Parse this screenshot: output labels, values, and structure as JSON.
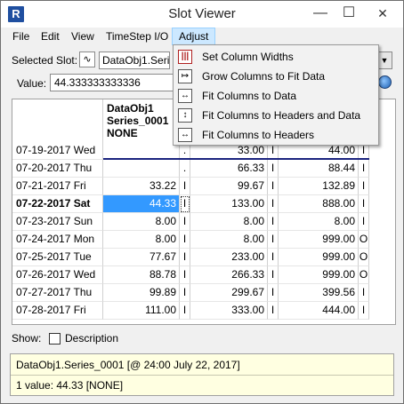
{
  "window": {
    "title": "Slot Viewer",
    "app_icon_letter": "R"
  },
  "menubar": [
    "File",
    "Edit",
    "View",
    "TimeStep I/O",
    "Adjust"
  ],
  "selected_slot": {
    "label": "Selected Slot:",
    "value": "DataObj1.Series_0001"
  },
  "value_field": {
    "label": "Value:",
    "value": "44.333333333336"
  },
  "columns": [
    {
      "header": [
        "DataObj1",
        "Series_0001",
        "NONE"
      ]
    },
    {
      "header": [
        "",
        "",
        ""
      ]
    },
    {
      "header": [
        "",
        "",
        ""
      ]
    }
  ],
  "rows": [
    {
      "date": "07-19-2017 Wed",
      "bold": false,
      "c1": "",
      "f1": ".",
      "c2": "33.00",
      "f2": "I",
      "c3": "44.00",
      "f3": "I"
    },
    {
      "date": "07-20-2017 Thu",
      "bold": false,
      "c1": "",
      "f1": ".",
      "c2": "66.33",
      "f2": "I",
      "c3": "88.44",
      "f3": "I"
    },
    {
      "date": "07-21-2017 Fri",
      "bold": false,
      "c1": "33.22",
      "f1": "I",
      "c2": "99.67",
      "f2": "I",
      "c3": "132.89",
      "f3": "I"
    },
    {
      "date": "07-22-2017 Sat",
      "bold": true,
      "c1": "44.33",
      "f1": "I",
      "c2": "133.00",
      "f2": "I",
      "c3": "888.00",
      "f3": "I"
    },
    {
      "date": "07-23-2017 Sun",
      "bold": false,
      "c1": "8.00",
      "f1": "I",
      "c2": "8.00",
      "f2": "I",
      "c3": "8.00",
      "f3": "I"
    },
    {
      "date": "07-24-2017 Mon",
      "bold": false,
      "c1": "8.00",
      "f1": "I",
      "c2": "8.00",
      "f2": "I",
      "c3": "999.00",
      "f3": "O"
    },
    {
      "date": "07-25-2017 Tue",
      "bold": false,
      "c1": "77.67",
      "f1": "I",
      "c2": "233.00",
      "f2": "I",
      "c3": "999.00",
      "f3": "O"
    },
    {
      "date": "07-26-2017 Wed",
      "bold": false,
      "c1": "88.78",
      "f1": "I",
      "c2": "266.33",
      "f2": "I",
      "c3": "999.00",
      "f3": "O"
    },
    {
      "date": "07-27-2017 Thu",
      "bold": false,
      "c1": "99.89",
      "f1": "I",
      "c2": "299.67",
      "f2": "I",
      "c3": "399.56",
      "f3": "I"
    },
    {
      "date": "07-28-2017 Fri",
      "bold": false,
      "c1": "111.00",
      "f1": "I",
      "c2": "333.00",
      "f2": "I",
      "c3": "444.00",
      "f3": "I"
    }
  ],
  "adjust_menu": [
    {
      "label": "Set Column Widths",
      "icon": "column-widths-icon"
    },
    {
      "label": "Grow Columns to Fit Data",
      "icon": "grow-columns-icon"
    },
    {
      "label": "Fit Columns to Data",
      "icon": "fit-data-icon"
    },
    {
      "label": "Fit Columns to Headers and Data",
      "icon": "fit-headers-data-icon"
    },
    {
      "label": "Fit Columns to Headers",
      "icon": "fit-headers-icon"
    }
  ],
  "show": {
    "label": "Show:",
    "checkbox_label": "Description",
    "checked": false
  },
  "info": {
    "line1": "DataObj1.Series_0001 [@ 24:00 July 22, 2017]",
    "line2": "1 value:  44.33 [NONE]"
  },
  "colors": {
    "selection": "#3399ff",
    "info_bg": "#ffffe1",
    "menu_highlight": "#cce8ff"
  }
}
